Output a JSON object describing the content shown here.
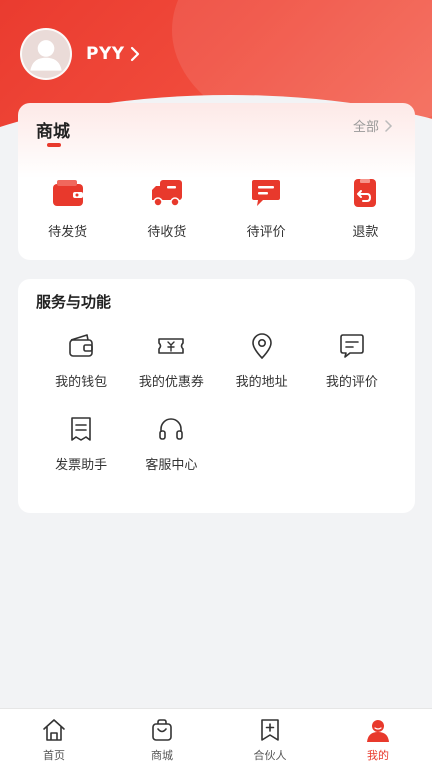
{
  "profile": {
    "username": "PYY"
  },
  "mall": {
    "title": "商城",
    "view_all": "全部",
    "items": [
      {
        "label": "待发货",
        "icon": "wallet-pending-ship-icon"
      },
      {
        "label": "待收货",
        "icon": "truck-icon"
      },
      {
        "label": "待评价",
        "icon": "comment-icon"
      },
      {
        "label": "退款",
        "icon": "refund-icon"
      }
    ]
  },
  "services": {
    "title": "服务与功能",
    "items": [
      {
        "label": "我的钱包",
        "icon": "wallet-icon"
      },
      {
        "label": "我的优惠券",
        "icon": "coupon-icon"
      },
      {
        "label": "我的地址",
        "icon": "location-pin-icon"
      },
      {
        "label": "我的评价",
        "icon": "review-icon"
      },
      {
        "label": "发票助手",
        "icon": "invoice-icon"
      },
      {
        "label": "客服中心",
        "icon": "headset-icon"
      }
    ]
  },
  "tabbar": {
    "items": [
      {
        "label": "首页",
        "icon": "home-icon"
      },
      {
        "label": "商城",
        "icon": "shopping-bag-icon"
      },
      {
        "label": "合伙人",
        "icon": "bookmark-plus-icon"
      },
      {
        "label": "我的",
        "icon": "user-icon",
        "active": true
      }
    ]
  },
  "colors": {
    "accent": "#e8392c",
    "background": "#f2f3f5",
    "text": "#333333"
  }
}
